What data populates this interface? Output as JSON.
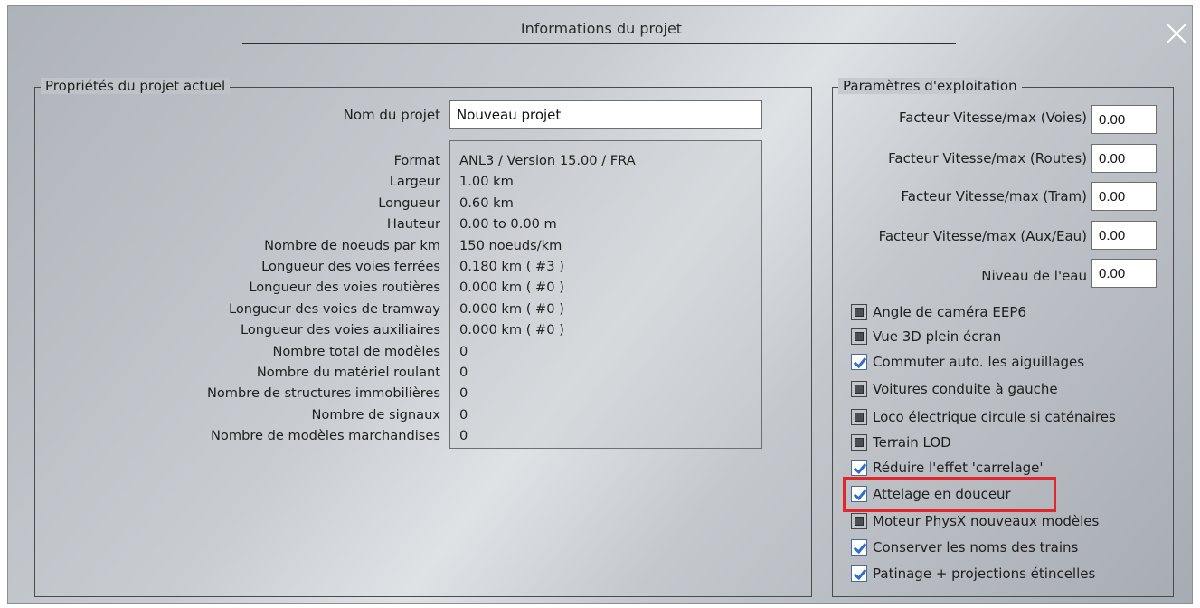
{
  "dialog": {
    "title": "Informations du projet"
  },
  "left_group": {
    "legend": "Propriétés du projet actuel",
    "project_name_label": "Nom du projet",
    "project_name_value": "Nouveau projet",
    "rows": [
      {
        "label": "Format",
        "value": "ANL3 / Version 15.00 / FRA"
      },
      {
        "label": "Largeur",
        "value": "1.00 km"
      },
      {
        "label": "Longueur",
        "value": "0.60 km"
      },
      {
        "label": "Hauteur",
        "value": "0.00 to 0.00 m"
      },
      {
        "label": "Nombre de noeuds par km",
        "value": "150 noeuds/km"
      },
      {
        "label": "Longueur des voies ferrées",
        "value": "0.180 km ( #3 )"
      },
      {
        "label": "Longueur des voies routières",
        "value": "0.000 km ( #0 )"
      },
      {
        "label": "Longueur des voies de tramway",
        "value": "0.000 km ( #0 )"
      },
      {
        "label": "Longueur des voies auxiliaires",
        "value": "0.000 km ( #0 )"
      },
      {
        "label": "Nombre total de modèles",
        "value": "0"
      },
      {
        "label": "Nombre du matériel roulant",
        "value": "0"
      },
      {
        "label": "Nombre de structures immobilières",
        "value": "0"
      },
      {
        "label": "Nombre de signaux",
        "value": "0"
      },
      {
        "label": "Nombre de modèles marchandises",
        "value": "0"
      }
    ]
  },
  "right_group": {
    "legend": "Paramètres d'exploitation",
    "params": [
      {
        "label": "Facteur Vitesse/max (Voies)",
        "value": "0.00"
      },
      {
        "label": "Facteur Vitesse/max (Routes)",
        "value": "0.00"
      },
      {
        "label": "Facteur Vitesse/max (Tram)",
        "value": "0.00"
      },
      {
        "label": "Facteur Vitesse/max (Aux/Eau)",
        "value": "0.00"
      },
      {
        "label": "Niveau de l'eau",
        "value": "0.00"
      }
    ],
    "checkboxes": [
      {
        "label": "Angle de caméra EEP6",
        "checked": false
      },
      {
        "label": "Vue 3D plein écran",
        "checked": false
      },
      {
        "label": "Commuter auto. les aiguillages",
        "checked": true
      },
      {
        "label": "Voitures conduite à gauche",
        "checked": false
      },
      {
        "label": "Loco électrique circule si caténaires",
        "checked": false
      },
      {
        "label": "Terrain LOD",
        "checked": false
      },
      {
        "label": "Réduire l'effet 'carrelage'",
        "checked": true
      },
      {
        "label": "Attelage en douceur",
        "checked": true
      },
      {
        "label": "Moteur PhysX nouveaux modèles",
        "checked": false
      },
      {
        "label": "Conserver les noms des trains",
        "checked": true
      },
      {
        "label": "Patinage + projections étincelles",
        "checked": true
      }
    ],
    "highlighted_option": "Attelage en douceur"
  },
  "colors": {
    "highlight": "#e0282a",
    "check_accent": "#2f6fc7"
  },
  "icons": {
    "close": "close-icon",
    "checked": "checkmark-icon",
    "unchecked": "unchecked-square-icon"
  }
}
